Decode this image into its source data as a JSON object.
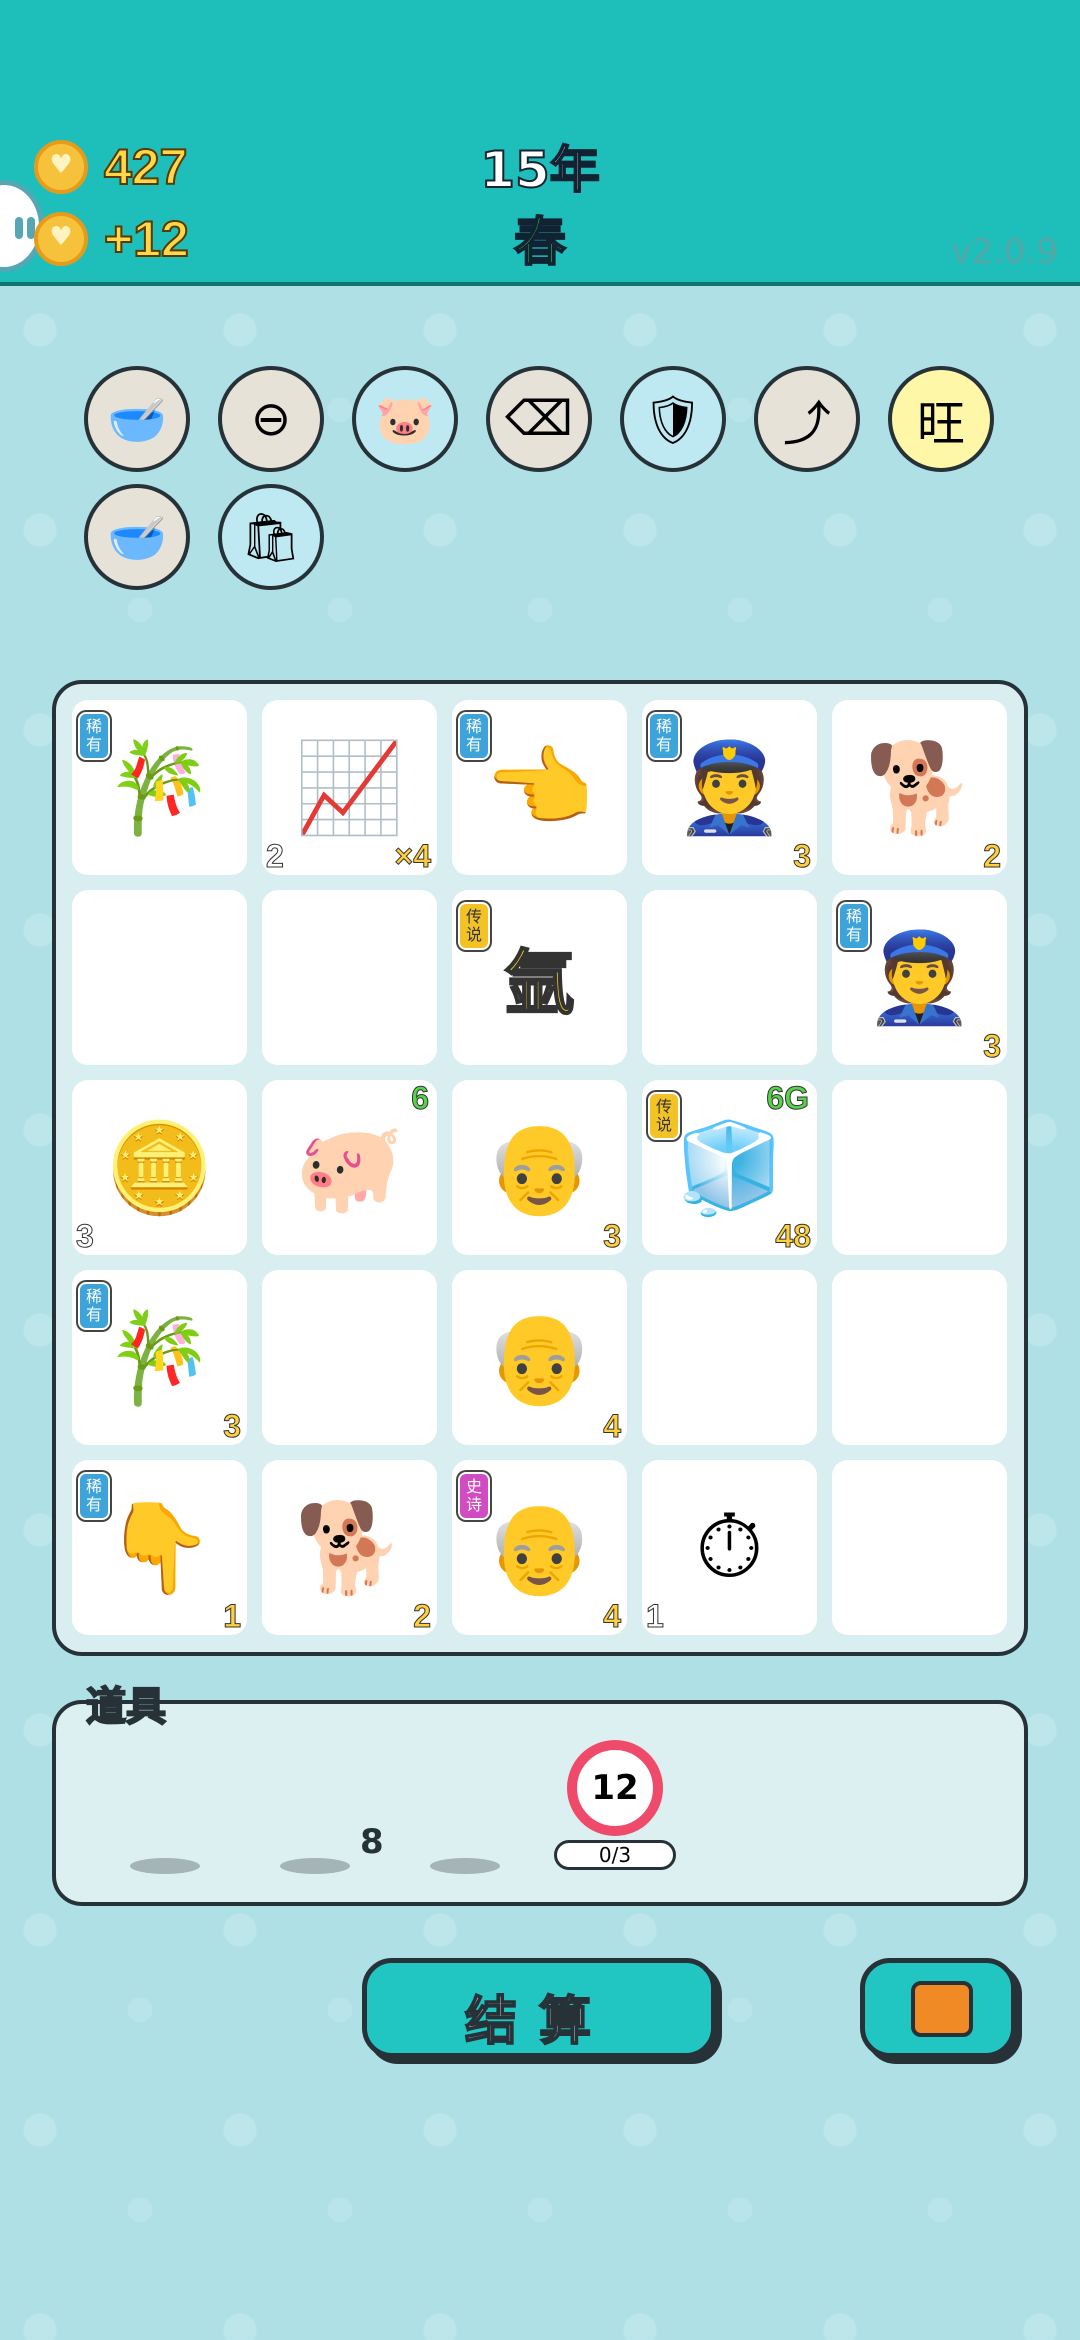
{
  "header": {
    "coins": "427",
    "income": "+12",
    "year": "15年",
    "season": "春",
    "version": "v2.0.9"
  },
  "relics": [
    {
      "icon": "dog-food-bowl-icon",
      "glyph": "🥣",
      "bg": "#e7e2d8"
    },
    {
      "icon": "minus-circle-icon",
      "glyph": "⊖",
      "bg": "#e7e2d8"
    },
    {
      "icon": "piggy-bank-icon",
      "glyph": "🐷",
      "bg": "#bfe9f2"
    },
    {
      "icon": "delete-tag-icon",
      "glyph": "⌫",
      "bg": "#e7e2d8"
    },
    {
      "icon": "shield-wrench-icon",
      "glyph": "🛡",
      "bg": "#bfe9f2"
    },
    {
      "icon": "upgrade-arrow-icon",
      "glyph": "⤴",
      "bg": "#e7e2d8"
    },
    {
      "icon": "wang-pattern-icon",
      "glyph": "旺",
      "bg": "#fff7a8"
    },
    {
      "icon": "dog-food-bowl-icon",
      "glyph": "🥣",
      "bg": "#e7e2d8"
    },
    {
      "icon": "trash-bag-icon",
      "glyph": "🛍",
      "bg": "#bfe9f2"
    }
  ],
  "board": [
    [
      {
        "icon": "bamboo-icon",
        "glyph": "🎋",
        "tag": "稀有",
        "tagType": "rare"
      },
      {
        "icon": "trend-chart-icon",
        "glyph": "📈",
        "bl": "2",
        "br": "×4"
      },
      {
        "icon": "pointing-hand-icon",
        "glyph": "👈",
        "tag": "稀有",
        "tagType": "rare"
      },
      {
        "icon": "police-officer-icon",
        "glyph": "👮",
        "tag": "稀有",
        "tagType": "rare",
        "br": "3"
      },
      {
        "icon": "husky-dog-icon",
        "glyph": "🐕",
        "br": "2"
      }
    ],
    [
      {},
      {},
      {
        "icon": "argon-element-icon",
        "text": "氩",
        "tag": "传说",
        "tagType": "legend"
      },
      {},
      {
        "icon": "police-officer-icon",
        "glyph": "👮",
        "tag": "稀有",
        "tagType": "rare",
        "br": "3"
      }
    ],
    [
      {
        "icon": "silver-bars-icon",
        "glyph": "🪙",
        "bl": "3"
      },
      {
        "icon": "pig-statue-icon",
        "glyph": "🐖",
        "tr": "6"
      },
      {
        "icon": "old-man-icon",
        "glyph": "👴",
        "br": "3"
      },
      {
        "icon": "fridge-icon",
        "glyph": "🧊",
        "tag": "传说",
        "tagType": "legend",
        "tr": "6G",
        "br": "48"
      },
      {}
    ],
    [
      {
        "icon": "bamboo-icon",
        "glyph": "🎋",
        "tag": "稀有",
        "tagType": "rare",
        "br": "3"
      },
      {},
      {
        "icon": "sleeping-old-man-icon",
        "glyph": "👴",
        "br": "4"
      },
      {},
      {}
    ],
    [
      {
        "icon": "pointing-hand-icon",
        "glyph": "👇",
        "tag": "稀有",
        "tagType": "rare",
        "br": "1"
      },
      {
        "icon": "husky-dog-icon",
        "glyph": "🐕",
        "br": "2"
      },
      {
        "icon": "bald-old-man-icon",
        "glyph": "👴",
        "tag": "史诗",
        "tagType": "epic",
        "br": "4"
      },
      {
        "icon": "stopwatch-card-icon",
        "glyph": "⏱",
        "bl": "1"
      },
      {}
    ]
  ],
  "props": {
    "title": "道具",
    "items": [
      {
        "icon": "piggy-bank-icon",
        "glyph": "🐷"
      },
      {
        "icon": "meat-icon",
        "glyph": "🥩",
        "count": "8"
      },
      {
        "icon": "crown-icon",
        "glyph": "👑"
      },
      {
        "icon": "reroll-token-icon",
        "value": "12",
        "progress": "0/3"
      }
    ]
  },
  "buttons": {
    "settle": "结算",
    "bag_icon": "briefcase-icon"
  }
}
